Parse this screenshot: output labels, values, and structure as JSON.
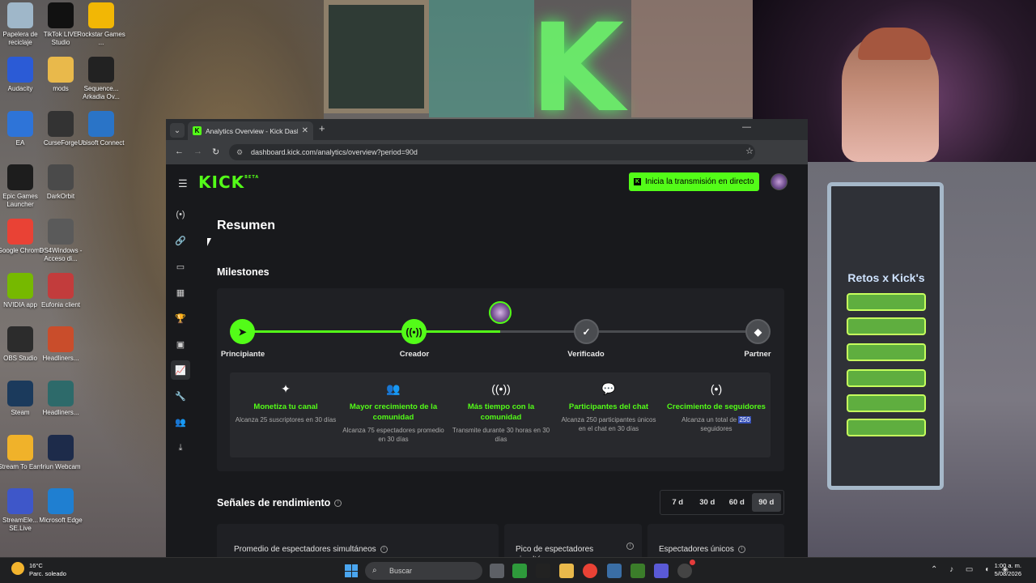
{
  "desktop": {
    "icons": [
      {
        "label": "Papelera de reciclaje",
        "icon": "recycle-bin-icon",
        "color": "#9fb7c9"
      },
      {
        "label": "TikTok LIVE Studio",
        "icon": "tiktok-icon",
        "color": "#111111"
      },
      {
        "label": "Rockstar Games ...",
        "icon": "rockstar-icon",
        "color": "#f2b705"
      },
      {
        "label": "Audacity",
        "icon": "audacity-icon",
        "color": "#2b5bd6"
      },
      {
        "label": "mods",
        "icon": "folder-icon",
        "color": "#e9b94b"
      },
      {
        "label": "Sequence... Arkadia Ov...",
        "icon": "sequence-icon",
        "color": "#222222"
      },
      {
        "label": "EA",
        "icon": "ea-icon",
        "color": "#2e74d8"
      },
      {
        "label": "CurseForge",
        "icon": "curseforge-icon",
        "color": "#333333"
      },
      {
        "label": "Ubisoft Connect",
        "icon": "ubisoft-icon",
        "color": "#2a74c7"
      },
      {
        "label": "Epic Games Launcher",
        "icon": "epic-icon",
        "color": "#1d1d1d"
      },
      {
        "label": "DarkOrbit",
        "icon": "darkorbit-icon",
        "color": "#4a4a4a"
      },
      {
        "label": "Google Chrome",
        "icon": "chrome-icon",
        "color": "#e94235"
      },
      {
        "label": "DS4Windows - Acceso di...",
        "icon": "ds4windows-icon",
        "color": "#5a5a5a"
      },
      {
        "label": "NVIDIA app",
        "icon": "nvidia-icon",
        "color": "#76b900"
      },
      {
        "label": "Eufonia client",
        "icon": "eufonia-icon",
        "color": "#c23c3c"
      },
      {
        "label": "OBS Studio",
        "icon": "obs-icon",
        "color": "#2c2c2c"
      },
      {
        "label": "Headliners...",
        "icon": "headliners-icon",
        "color": "#c94d2b"
      },
      {
        "label": "Steam",
        "icon": "steam-icon",
        "color": "#1b3a5c"
      },
      {
        "label": "Headliners...",
        "icon": "headliners-icon",
        "color": "#2d6a6a"
      },
      {
        "label": "Stream To Earn",
        "icon": "stream-to-earn-icon",
        "color": "#f0b22a"
      },
      {
        "label": "Iriun Webcam",
        "icon": "iriun-icon",
        "color": "#1d2b4a"
      },
      {
        "label": "StreamEle... SE.Live",
        "icon": "streamelements-icon",
        "color": "#3e57c9"
      },
      {
        "label": "Microsoft Edge",
        "icon": "edge-icon",
        "color": "#1f7fd1"
      }
    ]
  },
  "overlay": {
    "title": "Retos x Kick's"
  },
  "browser": {
    "tab_title": "Analytics Overview - Kick Dashb",
    "url": "dashboard.kick.com/analytics/overview?period=90d"
  },
  "app": {
    "logo": "KICK",
    "logo_badge": "BETA",
    "go_live_label": "Inicia la transmisión en directo",
    "page_title": "Resumen",
    "milestones_title": "Milestones",
    "milestones": [
      {
        "label": "Principiante",
        "state": "done"
      },
      {
        "label": "Creador",
        "state": "done"
      },
      {
        "label": "Verificado",
        "state": "todo"
      },
      {
        "label": "Partner",
        "state": "todo"
      }
    ],
    "milestone_progress": 0.5,
    "goals": [
      {
        "icon": "sparkle-icon",
        "glyph": "✦",
        "title": "Monetiza tu canal",
        "desc": "Alcanza 25 suscriptores en 30 días"
      },
      {
        "icon": "community-icon",
        "glyph": "👥",
        "title": "Mayor crecimiento de la comunidad",
        "desc": "Alcanza 75 espectadores promedio en 30 días"
      },
      {
        "icon": "broadcast-icon",
        "glyph": "((•))",
        "title": "Más tiempo con la comunidad",
        "desc": "Transmite durante 30 horas en 30 días"
      },
      {
        "icon": "chat-icon",
        "glyph": "💬",
        "title": "Participantes del chat",
        "desc": "Alcanza 250 participantes únicos en el chat en 30 días"
      },
      {
        "icon": "followers-icon",
        "glyph": "(•)",
        "title": "Crecimiento de seguidores",
        "desc_before": "Alcanza un total de ",
        "desc_highlight": "250",
        "desc_after": " seguidores"
      }
    ],
    "performance_title": "Señales de rendimiento",
    "periods": [
      "7 d",
      "30 d",
      "60 d",
      "90 d"
    ],
    "active_period": "90 d",
    "cards": [
      {
        "title": "Promedio de espectadores simultáneos"
      },
      {
        "title": "Pico de espectadores simultáneos"
      },
      {
        "title": "Espectadores únicos"
      }
    ]
  },
  "taskbar": {
    "temperature": "16°C",
    "weather": "Parc. soleado",
    "search_placeholder": "Buscar",
    "time": "1:00 a. m.",
    "date": "5/08/2026"
  },
  "colors": {
    "accent": "#53fc18",
    "app_bg": "#18191c",
    "card_bg": "#1f2024"
  }
}
